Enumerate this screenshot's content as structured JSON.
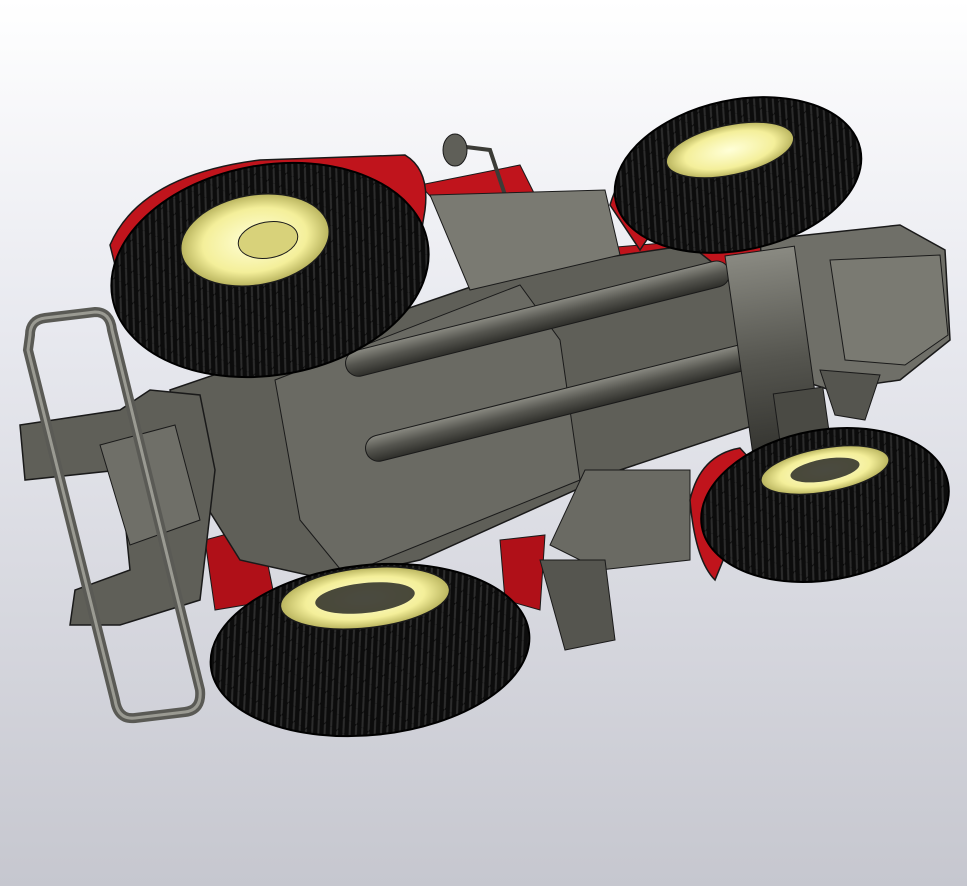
{
  "viewport": {
    "background_top": "#ffffff",
    "background_bottom": "#c6c7cf"
  },
  "model": {
    "subject": "tractor",
    "view": "underside",
    "render_style": "wireframe-shaded",
    "colors": {
      "chassis": "#5f5f58",
      "chassis_light": "#7a7a72",
      "chassis_dark": "#3c3c37",
      "tire": "#0c0c0c",
      "rim": "#f4ef9a",
      "fender": "#c0141c",
      "edge": "#1a1a1a"
    }
  }
}
